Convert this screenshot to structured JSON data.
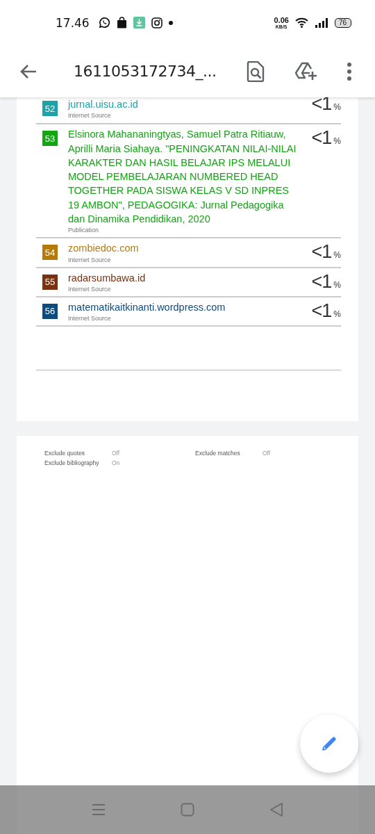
{
  "status_bar": {
    "time": "17.46",
    "net_speed": "0.06",
    "net_unit": "KB/S",
    "battery": "76"
  },
  "app_bar": {
    "title": "1611053172734_..."
  },
  "matches": [
    {
      "number": "52",
      "color": "#1aa3a8",
      "title": "jurnal.uisu.ac.id",
      "source_type": "Internet Source",
      "percent": "<1",
      "percent_sign": "%"
    },
    {
      "number": "53",
      "color": "#13a513",
      "title": "Elsinora Mahananingtyas, Samuel Patra Ritiauw, Aprilli Maria Siahaya. \"PENINGKATAN NILAI-NILAI KARAKTER DAN HASIL BELAJAR IPS MELALUI MODEL PEMBELAJARAN NUMBERED HEAD TOGETHER PADA SISWA KELAS V SD INPRES 19 AMBON\", PEDAGOGIKA: Jurnal Pedagogika dan Dinamika Pendidikan, 2020",
      "source_type": "Publication",
      "percent": "<1",
      "percent_sign": "%"
    },
    {
      "number": "54",
      "color": "#b47b0c",
      "title": "zombiedoc.com",
      "source_type": "Internet Source",
      "percent": "<1",
      "percent_sign": "%"
    },
    {
      "number": "55",
      "color": "#7a3110",
      "title": "radarsumbawa.id",
      "source_type": "Internet Source",
      "percent": "<1",
      "percent_sign": "%"
    },
    {
      "number": "56",
      "color": "#0e4a7c",
      "title": "matematikaitkinanti.wordpress.com",
      "source_type": "Internet Source",
      "percent": "<1",
      "percent_sign": "%"
    }
  ],
  "settings": [
    {
      "label": "Exclude quotes",
      "value": "Off"
    },
    {
      "label": "Exclude matches",
      "value": "Off"
    },
    {
      "label": "Exclude bibliography",
      "value": "On"
    }
  ]
}
